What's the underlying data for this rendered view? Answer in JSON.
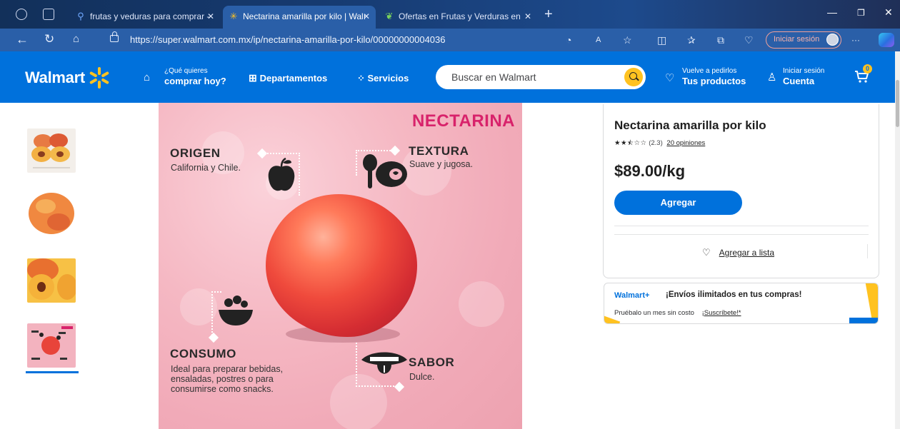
{
  "browser": {
    "tabs": [
      {
        "title": "frutas y veduras para comprar - ",
        "active": false
      },
      {
        "title": "Nectarina amarilla por kilo | Walı",
        "active": true
      },
      {
        "title": "Ofertas en Frutas y Verduras en ",
        "active": false
      }
    ],
    "url": "https://super.walmart.com.mx/ip/nectarina-amarilla-por-kilo/00000000004036",
    "signin_label": "Iniciar sesión",
    "more_label": "···"
  },
  "header": {
    "logo_text": "Walmart",
    "what_small": "¿Qué quieres",
    "what_big": "comprar hoy?",
    "departments": "Departamentos",
    "services": "Servicios",
    "search_placeholder": "Buscar en Walmart",
    "reorder_small": "Vuelve a pedirlos",
    "reorder_big": "Tus productos",
    "account_small": "Iniciar sesión",
    "account_big": "Cuenta",
    "cart_count": "0",
    "accent": "#0071dc",
    "spark_color": "#ffc220"
  },
  "hero": {
    "title": "NECTARINA",
    "origin_heading": "ORIGEN",
    "origin_text": "California y Chile.",
    "texture_heading": "TEXTURA",
    "texture_text": "Suave y jugosa.",
    "consumption_heading": "CONSUMO",
    "consumption_lines": [
      "Ideal para preparar bebidas,",
      "ensaladas, postres o para",
      "consumirse como snacks."
    ],
    "flavor_heading": "SABOR",
    "flavor_text": "Dulce."
  },
  "product": {
    "title": "Nectarina amarilla por kilo",
    "stars": "★★⯪☆☆",
    "rating": "(2.3)",
    "reviews": "20 opiniones",
    "price": "$89.00/kg",
    "add_button": "Agregar",
    "add_to_list": "Agregar a lista"
  },
  "plus": {
    "logo": "Walmart+",
    "headline": "¡Envíos ilimitados en tus compras!",
    "sub": "Pruébalo un mes sin costo",
    "cta": "¡Suscríbete!*"
  }
}
